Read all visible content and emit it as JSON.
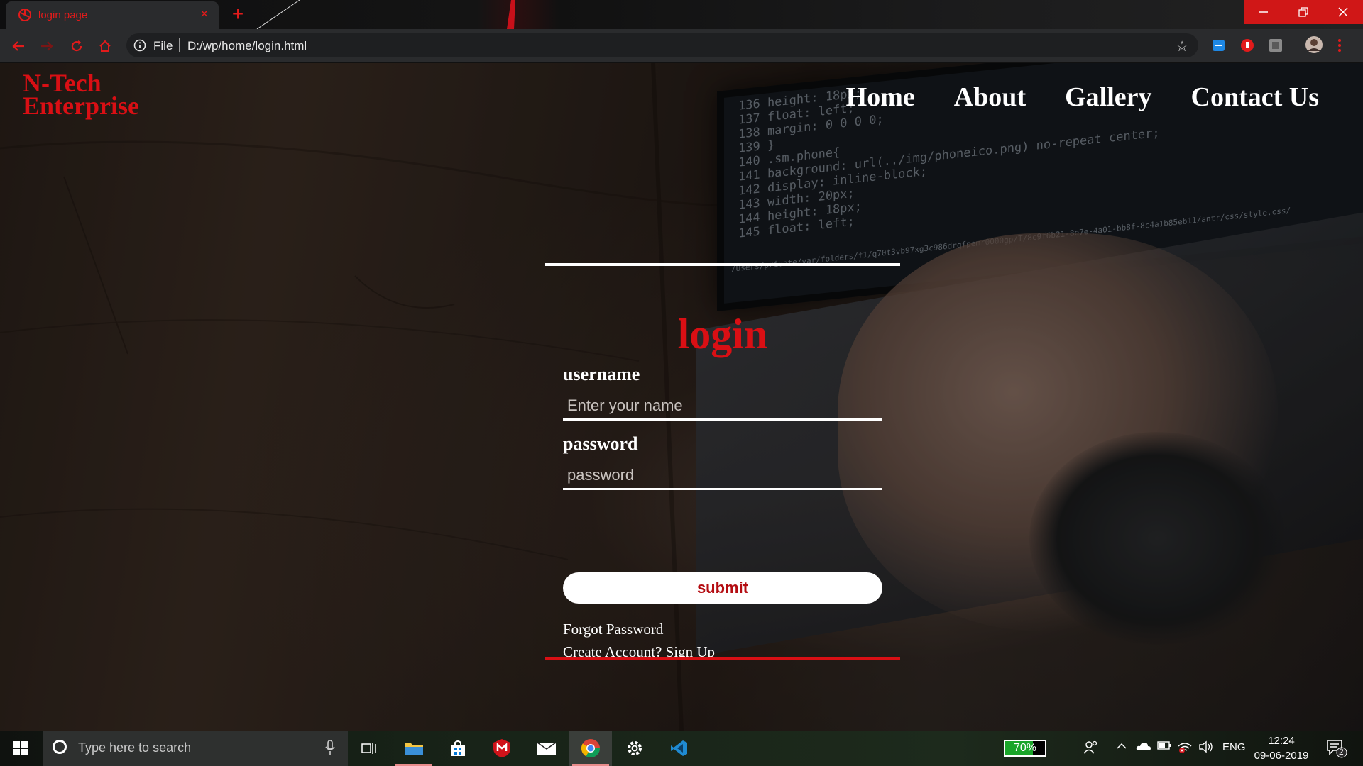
{
  "browser": {
    "tab_title": "login page",
    "tab_close": "×",
    "new_tab": "+",
    "address_scheme": "File",
    "address_url": "D:/wp/home/login.html"
  },
  "site": {
    "brand_line1": "N-Tech",
    "brand_line2": "Enterprise",
    "nav": [
      "Home",
      "About",
      "Gallery",
      "Contact Us"
    ]
  },
  "login": {
    "title": "login",
    "username_label": "username",
    "username_placeholder": "Enter your name",
    "password_label": "password",
    "password_placeholder": "password",
    "submit_label": "submit",
    "forgot_link": "Forgot Password",
    "signup_link": "Create Account? Sign Up"
  },
  "background_code": [
    "136   height: 18px;",
    "137   float: left;",
    "138   margin: 0 0 0 0;",
    "139 }",
    "140 .sm.phone{",
    "141   background: url(../img/phoneico.png) no-repeat center;",
    "142   display: inline-block;",
    "143   width: 20px;",
    "144   height: 18px;",
    "145   float: left;"
  ],
  "background_path": "/Users/private/var/folders/f1/q70t3vb97xg3c986drqfpemr0000gp/T/8c9f6b21-8e7e-4a01-bb8f-8c4a1b85eb11/antr/css/style.css/",
  "taskbar": {
    "search_placeholder": "Type here to search",
    "battery": "70%",
    "language": "ENG",
    "time": "12:24",
    "date": "09-06-2019",
    "notification_count": "2"
  },
  "colors": {
    "accent_red": "#d90f14",
    "chrome_dark": "#2a2b2d"
  }
}
